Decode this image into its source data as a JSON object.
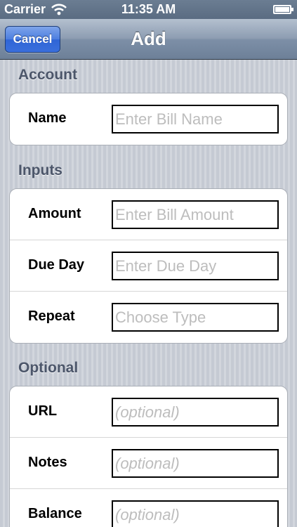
{
  "status_bar": {
    "carrier": "Carrier",
    "time": "11:35 AM",
    "wifi_icon": "wifi-icon",
    "battery_icon": "battery-icon"
  },
  "nav": {
    "title": "Add",
    "cancel_label": "Cancel"
  },
  "sections": {
    "account": {
      "header": "Account",
      "rows": [
        {
          "label": "Name",
          "placeholder": "Enter Bill Name",
          "value": ""
        }
      ]
    },
    "inputs": {
      "header": "Inputs",
      "rows": [
        {
          "label": "Amount",
          "placeholder": "Enter Bill Amount",
          "value": ""
        },
        {
          "label": "Due Day",
          "placeholder": "Enter Due Day",
          "value": ""
        },
        {
          "label": "Repeat",
          "placeholder": "Choose Type",
          "value": ""
        }
      ]
    },
    "optional": {
      "header": "Optional",
      "rows": [
        {
          "label": "URL",
          "placeholder": "(optional)",
          "value": ""
        },
        {
          "label": "Notes",
          "placeholder": "(optional)",
          "value": ""
        },
        {
          "label": "Balance",
          "placeholder": "(optional)",
          "value": ""
        }
      ]
    }
  },
  "colors": {
    "nav_bar": "#8d9db2",
    "cancel_button": "#3a6fdc",
    "section_header_text": "#4c566a",
    "background": "#c9ced6"
  }
}
